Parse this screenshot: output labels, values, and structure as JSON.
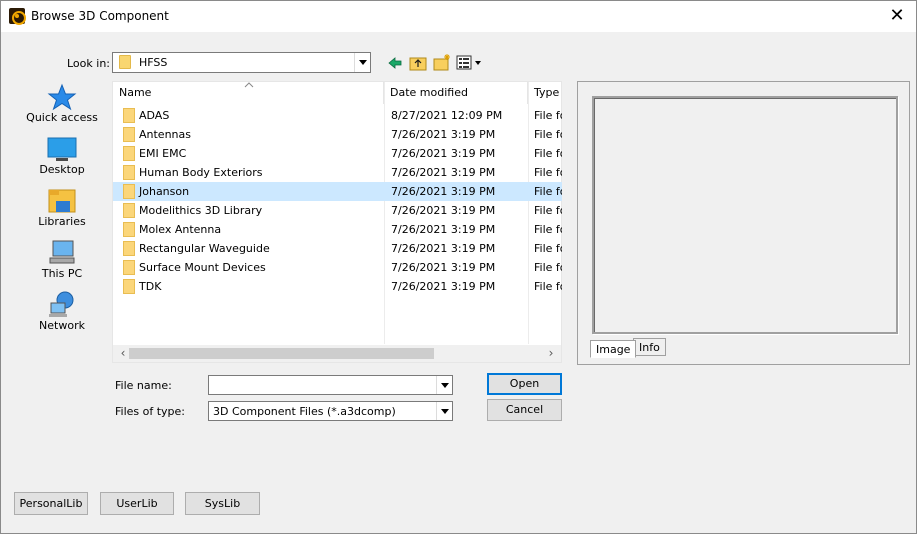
{
  "window": {
    "title": "Browse 3D Component",
    "close_label": "✕"
  },
  "lookin": {
    "label": "Look in:",
    "value": "HFSS"
  },
  "toolbar": {
    "back": "back-icon",
    "up": "up-folder-icon",
    "new": "new-folder-icon",
    "view": "view-menu-icon"
  },
  "places": [
    {
      "label": "Quick access",
      "icon": "star-icon"
    },
    {
      "label": "Desktop",
      "icon": "desktop-icon"
    },
    {
      "label": "Libraries",
      "icon": "libraries-icon"
    },
    {
      "label": "This PC",
      "icon": "computer-icon"
    },
    {
      "label": "Network",
      "icon": "network-icon"
    }
  ],
  "columns": {
    "name": "Name",
    "date": "Date modified",
    "type": "Type"
  },
  "files": [
    {
      "name": "ADAS",
      "date": "8/27/2021 12:09 PM",
      "type": "File fo",
      "selected": false
    },
    {
      "name": "Antennas",
      "date": "7/26/2021 3:19 PM",
      "type": "File fo",
      "selected": false
    },
    {
      "name": "EMI EMC",
      "date": "7/26/2021 3:19 PM",
      "type": "File fo",
      "selected": false
    },
    {
      "name": "Human Body Exteriors",
      "date": "7/26/2021 3:19 PM",
      "type": "File fo",
      "selected": false
    },
    {
      "name": "Johanson",
      "date": "7/26/2021 3:19 PM",
      "type": "File fo",
      "selected": true
    },
    {
      "name": "Modelithics 3D Library",
      "date": "7/26/2021 3:19 PM",
      "type": "File fo",
      "selected": false
    },
    {
      "name": "Molex Antenna",
      "date": "7/26/2021 3:19 PM",
      "type": "File fo",
      "selected": false
    },
    {
      "name": "Rectangular Waveguide",
      "date": "7/26/2021 3:19 PM",
      "type": "File fo",
      "selected": false
    },
    {
      "name": "Surface Mount Devices",
      "date": "7/26/2021 3:19 PM",
      "type": "File fo",
      "selected": false
    },
    {
      "name": "TDK",
      "date": "7/26/2021 3:19 PM",
      "type": "File fo",
      "selected": false
    }
  ],
  "filename": {
    "label": "File name:",
    "value": ""
  },
  "filetype": {
    "label": "Files of type:",
    "value": "3D Component Files (*.a3dcomp)"
  },
  "buttons": {
    "open": "Open",
    "cancel": "Cancel",
    "personal": "PersonalLib",
    "user": "UserLib",
    "sys": "SysLib"
  },
  "preview": {
    "tab_image": "Image",
    "tab_info": "Info"
  },
  "colors": {
    "selection": "#cce8ff",
    "folder": "#fbd67a",
    "accent": "#0078d7"
  }
}
